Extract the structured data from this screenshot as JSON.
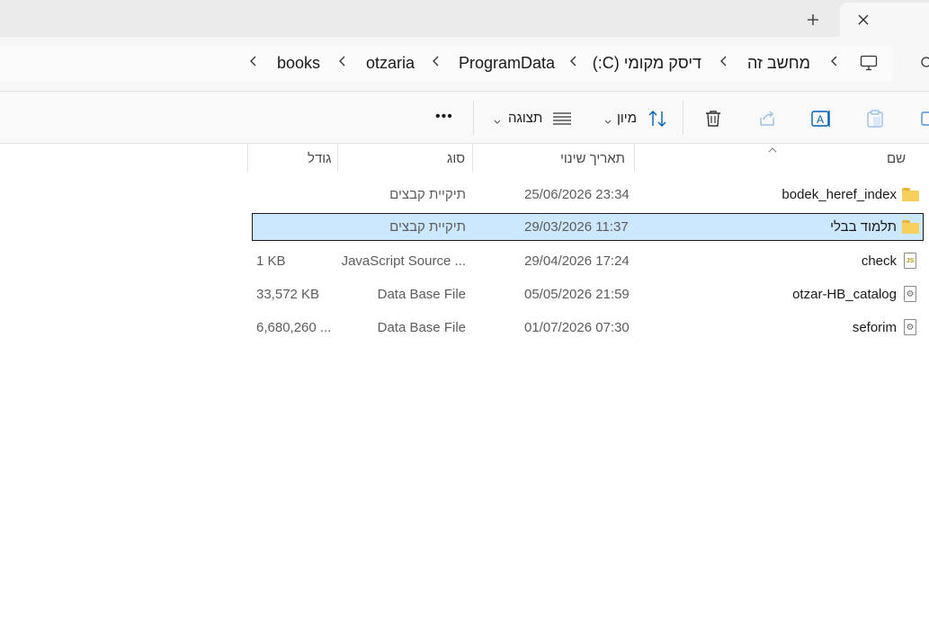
{
  "tabbar": {
    "new_tab_icon": "plus-icon",
    "close_icon": "close-icon"
  },
  "breadcrumb": {
    "items": [
      {
        "label": "מחשב זה"
      },
      {
        "label": "דיסק מקומי (C:)"
      },
      {
        "label": "ProgramData"
      },
      {
        "label": "otzaria"
      },
      {
        "label": "books"
      }
    ],
    "monitor_icon": "monitor-icon",
    "overflow_chevron": "chevron-left-icon"
  },
  "commandbar": {
    "sort_label": "מיון",
    "view_label": "תצוגה",
    "more_label": "•••",
    "icons": [
      "copy-icon",
      "paste-icon",
      "rename-icon",
      "share-icon",
      "delete-icon",
      "sort-icon",
      "view-icon"
    ]
  },
  "columns": {
    "name": "שם",
    "date": "תאריך שינוי",
    "type": "סוג",
    "size": "גודל"
  },
  "files": [
    {
      "name": "bodek_heref_index",
      "date": "25/06/2026 23:34",
      "type": "תיקיית קבצים",
      "size": "",
      "icon": "folder-icon",
      "selected": false
    },
    {
      "name": "תלמוד בבלי",
      "date": "29/03/2026 11:37",
      "type": "תיקיית קבצים",
      "size": "",
      "icon": "folder-icon",
      "selected": true
    },
    {
      "name": "check",
      "date": "29/04/2026 17:24",
      "type": "JavaScript Source ...",
      "size": "1 KB",
      "icon": "js-file-icon",
      "selected": false
    },
    {
      "name": "otzar-HB_catalog",
      "date": "05/05/2026 21:59",
      "type": "Data Base File",
      "size": "33,572 KB",
      "icon": "db-file-icon",
      "selected": false
    },
    {
      "name": "seforim",
      "date": "01/07/2026 07:30",
      "type": "Data Base File",
      "size": "6,680,260 ...",
      "icon": "db-file-icon",
      "selected": false
    }
  ],
  "colors": {
    "selection": "#cce8ff",
    "folder": "#f8cf5c",
    "accent": "#005fb8"
  }
}
